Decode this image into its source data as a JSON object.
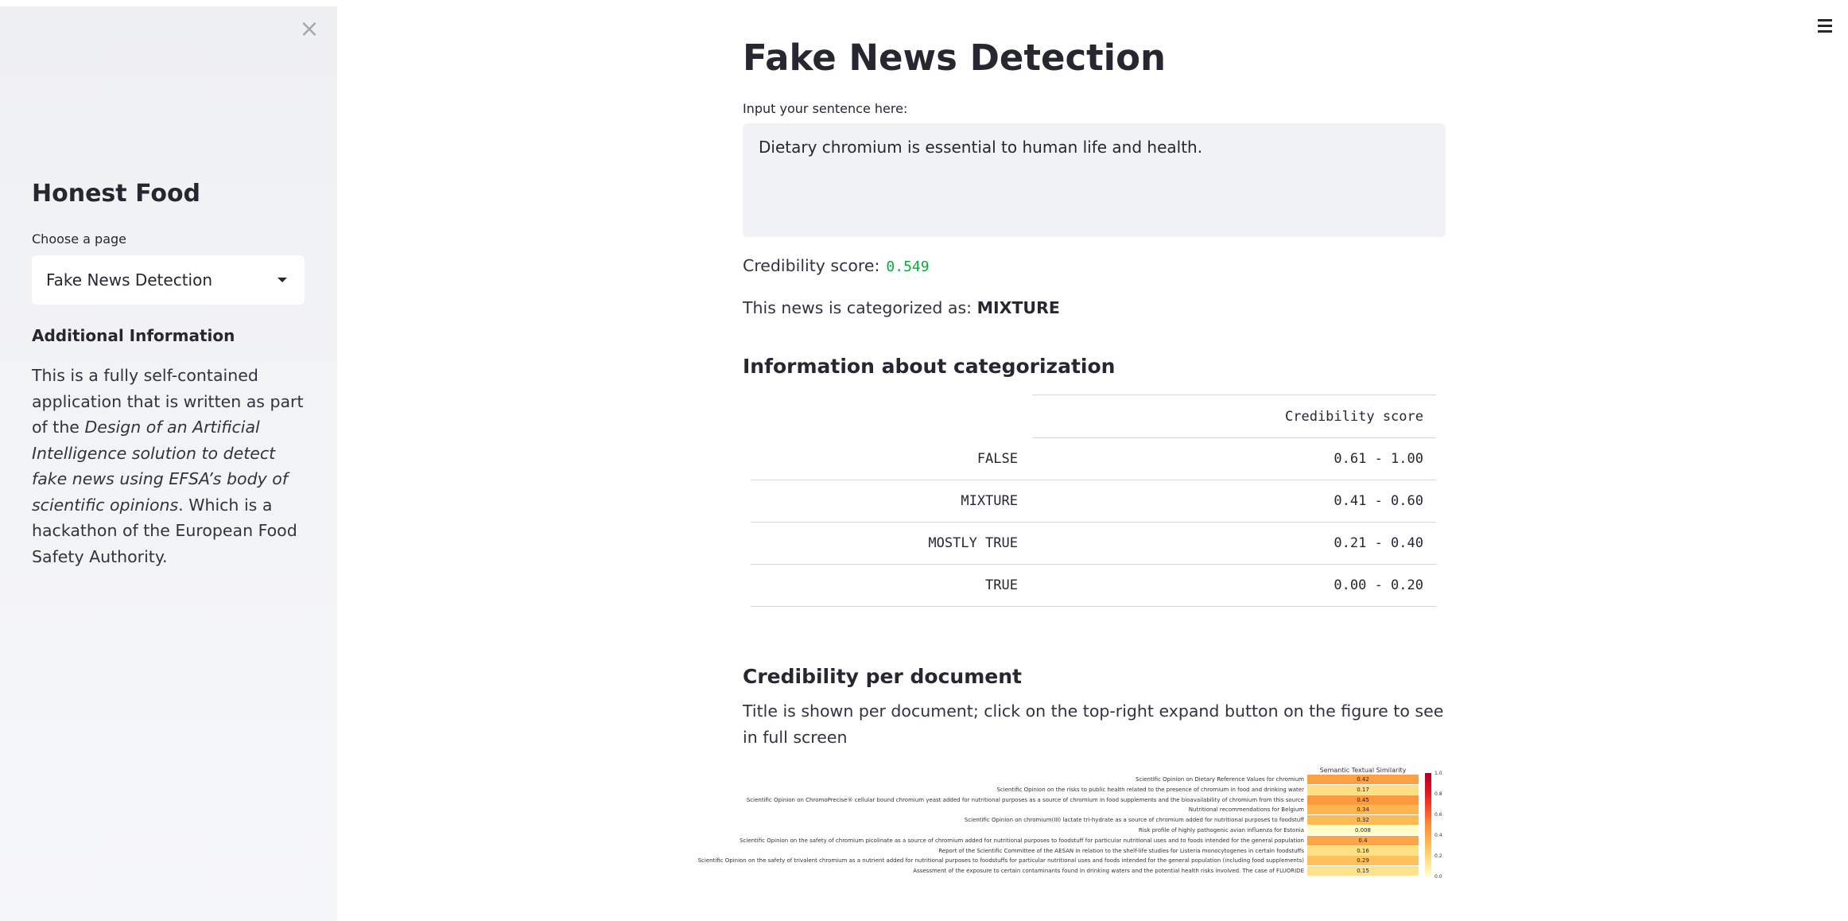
{
  "sidebar": {
    "close_icon": "×",
    "title": "Honest Food",
    "choose_label": "Choose a page",
    "selected_page": "Fake News Detection",
    "additional_heading": "Additional Information",
    "para_1": "This is a fully self-contained application that is written as part of the ",
    "para_italic": "Design of an Artificial Intelligence solution to detect fake news using EFSA’s body of scientific opinions",
    "para_2": ". Which is a hackathon of the European Food Safety Authority."
  },
  "main": {
    "title": "Fake News Detection",
    "input_label": "Input your sentence here:",
    "input_value": "Dietary chromium is essential to human life and health.",
    "credibility_label": "Credibility score:",
    "credibility_value": "0.549",
    "category_prefix": "This news is categorized as: ",
    "category_value": "MIXTURE",
    "info_heading": "Information about categorization",
    "table": {
      "header": "Credibility score",
      "rows": [
        {
          "label": "FALSE",
          "range": "0.61 - 1.00"
        },
        {
          "label": "MIXTURE",
          "range": "0.41 - 0.60"
        },
        {
          "label": "MOSTLY TRUE",
          "range": "0.21 - 0.40"
        },
        {
          "label": "TRUE",
          "range": "0.00 - 0.20"
        }
      ]
    },
    "doc_heading": "Credibility per document",
    "doc_desc": "Title is shown per document; click on the top-right expand button on the figure to see in full screen"
  },
  "chart_data": {
    "type": "heatmap",
    "title": "Semantic Textual Similarity",
    "rows": [
      "Scientific Opinion on Dietary Reference Values for chromium",
      "Scientific Opinion on the risks to public health related to the presence of chromium in food and drinking water",
      "Scientific Opinion on ChromoPrecise® cellular bound chromium yeast added for nutritional purposes as a source of chromium in food supplements and the bioavailability of chromium from this source",
      "Nutritional recommendations for Belgium",
      "Scientific Opinion on chromium(III) lactate tri-hydrate as a source of chromium added for nutritional purposes to foodstuff",
      "Risk profile of highly pathogenic avian influenza for Estonia",
      "Scientific Opinion on the safety of chromium picolinate as a source of chromium added for nutritional purposes to foodstuff for particular nutritional uses and to foods intended for the general population",
      "Report of the Scientific Committee of the AESAN in relation to the shelf-life studies for Listeria monocytogenes in certain foodstuffs",
      "Scientific Opinion on the safety of trivalent chromium as a nutrient added for nutritional purposes to foodstuffs for particular nutritional uses and foods intended for the general population (including food supplements)",
      "Assessment of the exposure to certain contaminants found in drinking waters and the potential health risks involved. The case of FLUORIDE"
    ],
    "labels": [
      "0.42",
      "0.17",
      "0.45",
      "0.34",
      "0.32",
      "0.008",
      "0.4",
      "0.16",
      "0.29",
      "0.15"
    ],
    "values": [
      0.42,
      0.17,
      0.45,
      0.34,
      0.32,
      0.008,
      0.4,
      0.16,
      0.29,
      0.15
    ],
    "colorbar_ticks": [
      "1.0",
      "0.8",
      "0.6",
      "0.4",
      "0.2",
      "0.0"
    ],
    "vmin": 0.0,
    "vmax": 1.0
  }
}
